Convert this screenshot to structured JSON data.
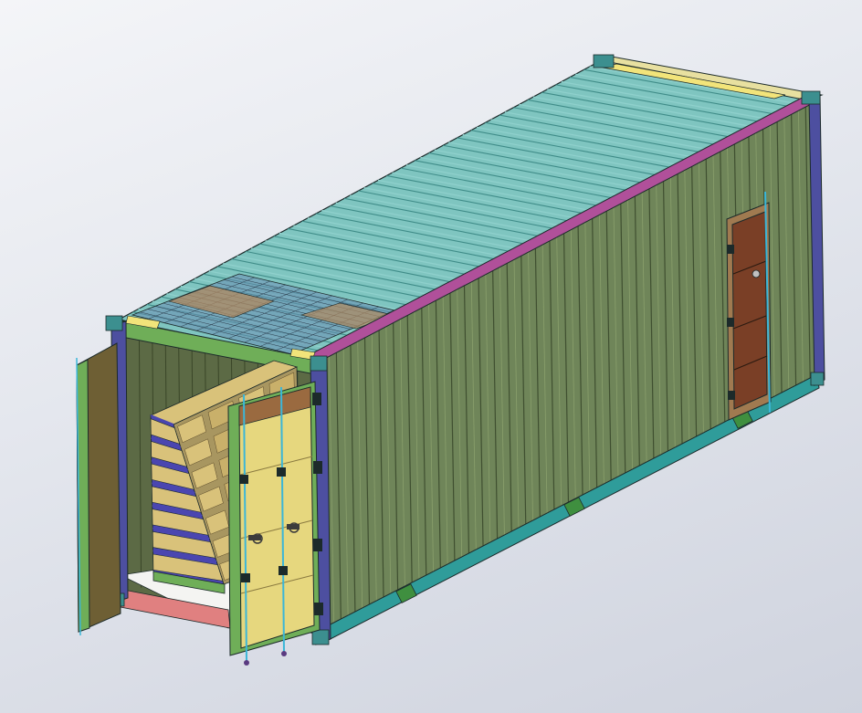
{
  "viewport": {
    "background_top": "#f4f5f8",
    "background_bottom": "#cfd3de"
  },
  "model": {
    "object": "shipping-container",
    "roof_panel_count": 34,
    "side_corrugation_count": 70,
    "end_corrugation_count": 14,
    "battery_rack_rows": 7,
    "battery_rack_columns": 4,
    "colors": {
      "roof_corrugation_light": "#8fd0cc",
      "roof_corrugation_dark": "#3f8c88",
      "side_wall": "#70865a",
      "side_wall_dark": "#3f4f30",
      "top_rail": "#b0509a",
      "bottom_rail": "#2f9c9a",
      "corner_post": "#4d4fa0",
      "door_frame": "#6fae58",
      "door_panel": "#e6d77e",
      "side_door": "#7a3f26",
      "rack_frame": "#4a46b0",
      "rack_tray": "#d9c27a",
      "floor_edge": "#e08080",
      "corner_casting": "#3c8f8f"
    }
  }
}
